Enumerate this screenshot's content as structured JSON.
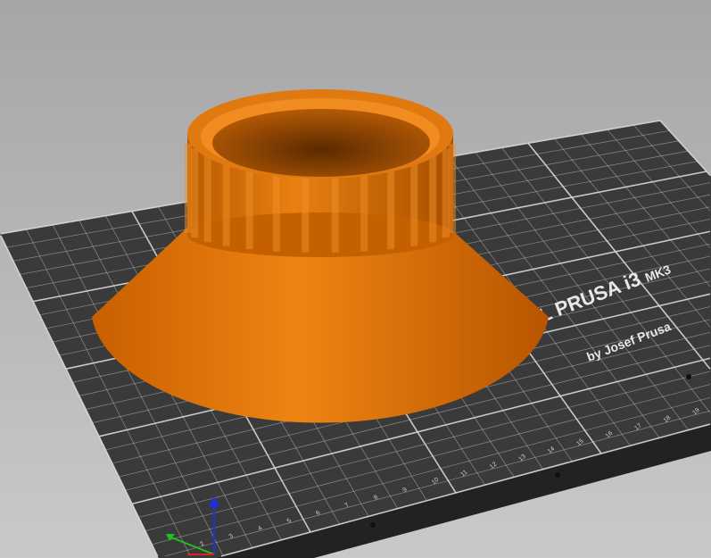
{
  "viewport": {
    "bed_logo": "ORIGINAL PRUSA i3",
    "bed_logo_model": "MK3",
    "bed_logo_by": "by Josef Prusa",
    "grid_divisions": 25,
    "colors": {
      "bed": "#3a3a3a",
      "grid": "#d8d8d8",
      "model": "#e07a10",
      "axis_x": "#e02020",
      "axis_y": "#20c020",
      "axis_z": "#2030e0"
    }
  }
}
